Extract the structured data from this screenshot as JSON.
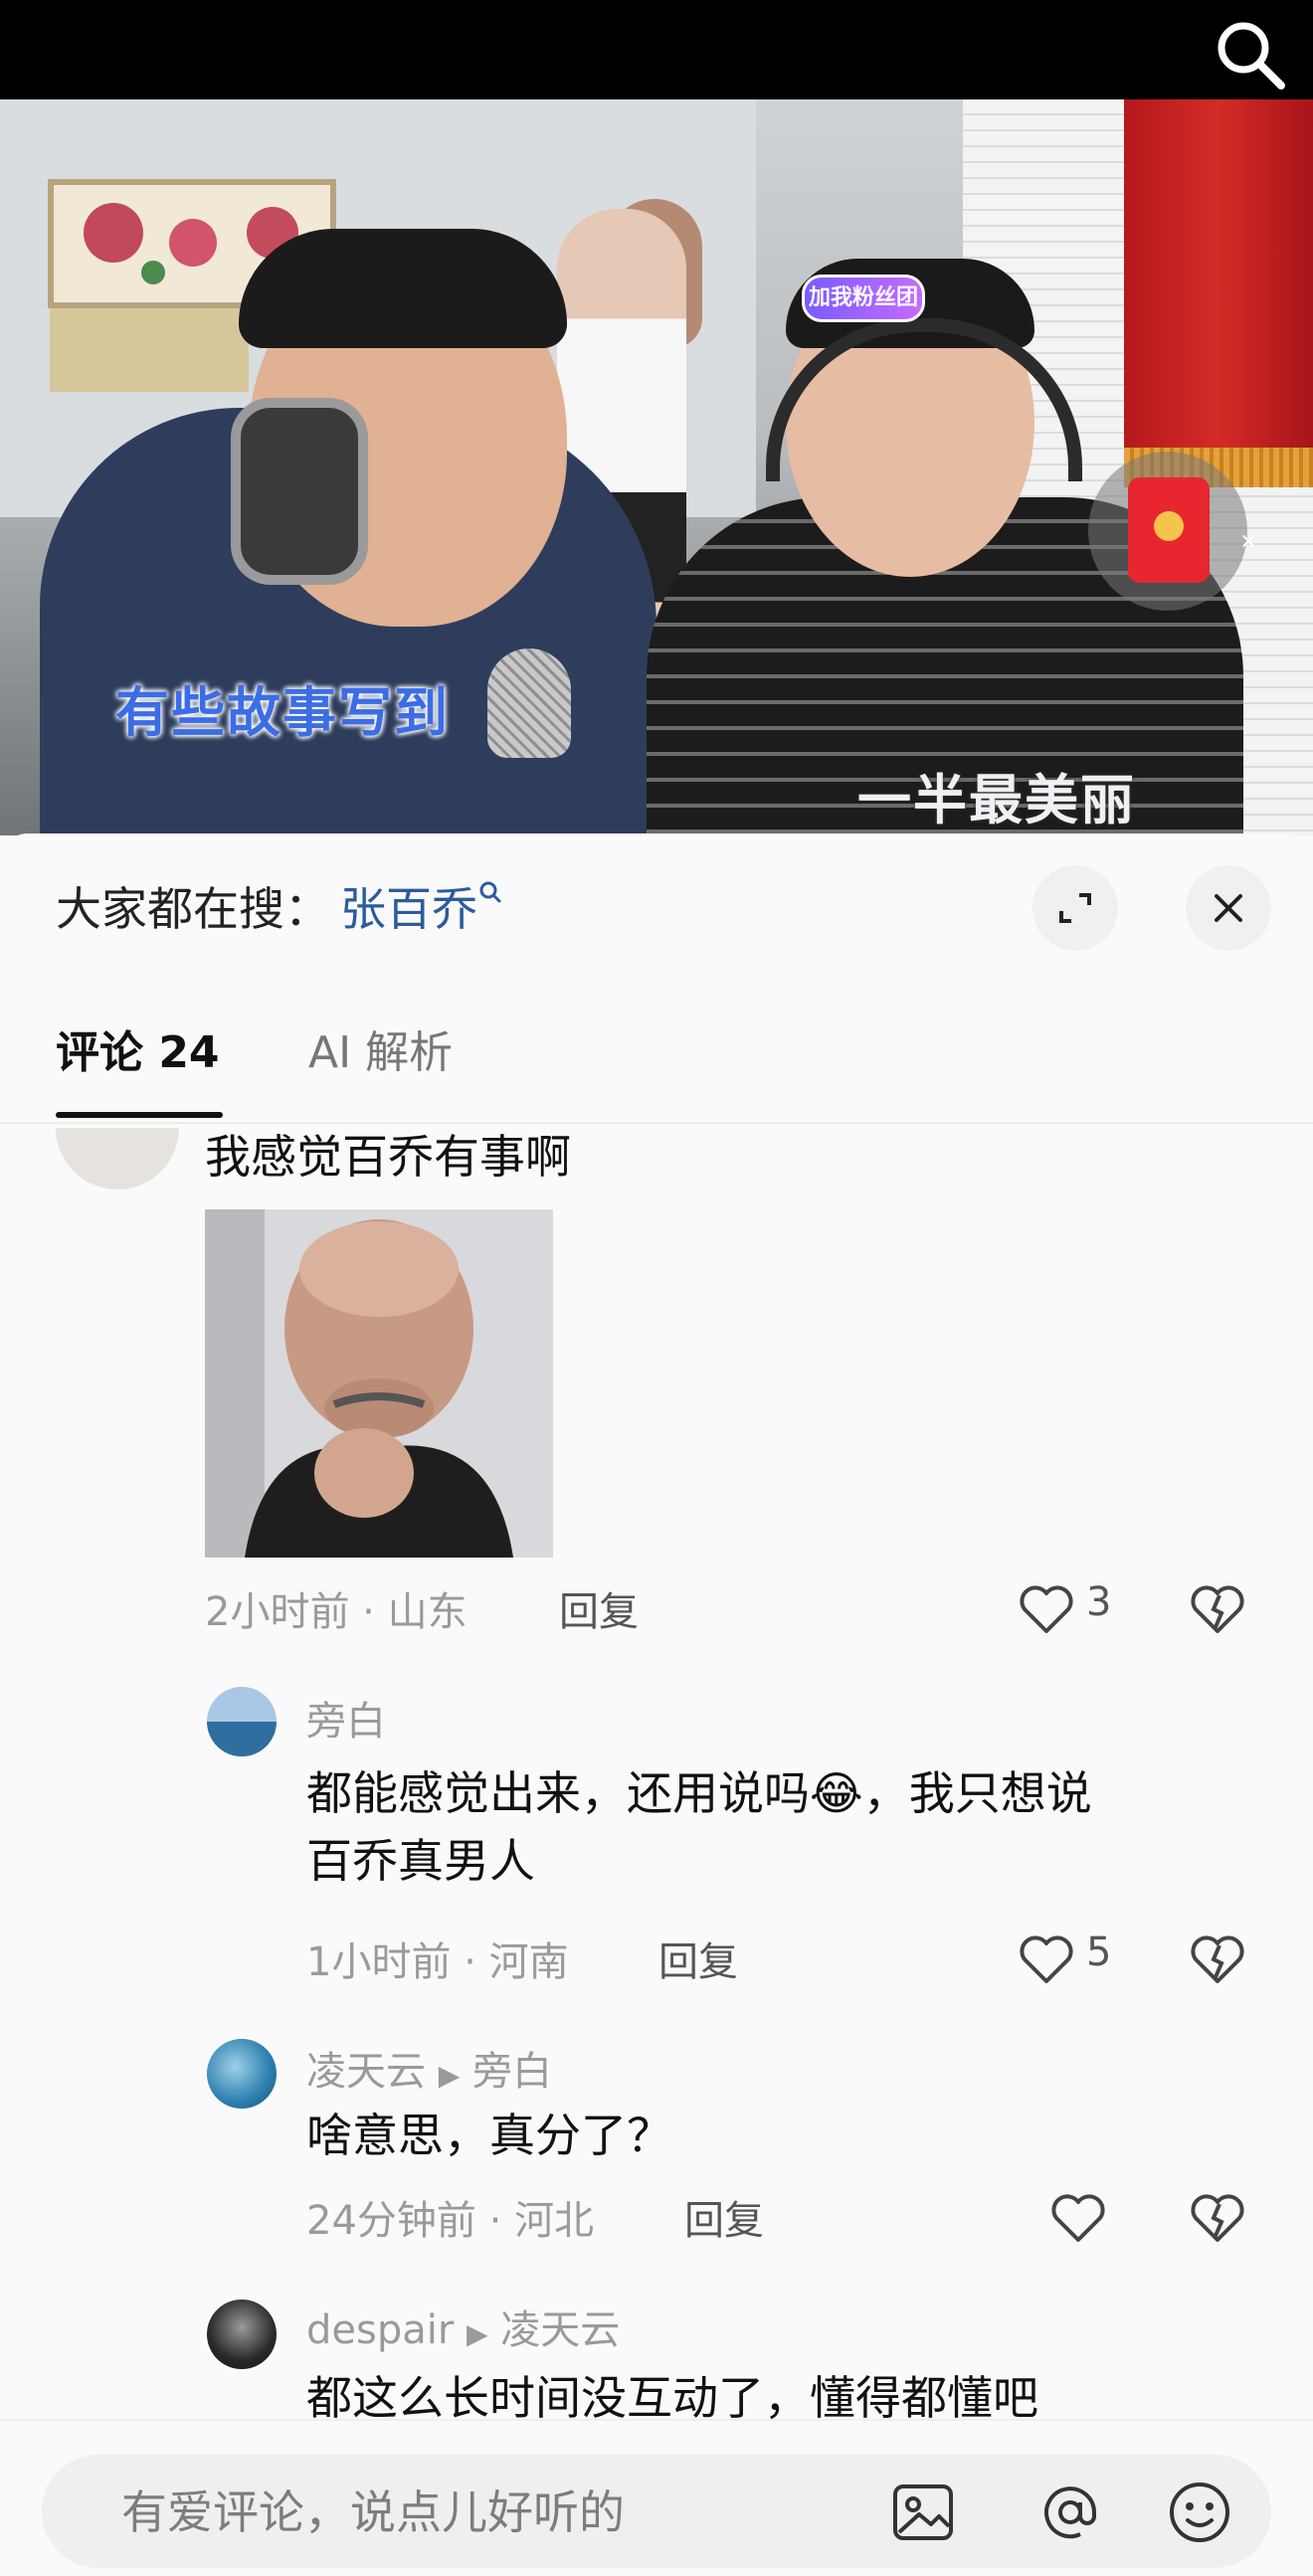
{
  "video": {
    "subtitle_left": "有些故事写到",
    "subtitle_right": "一半最美丽",
    "fan_badge": "加我粉丝团"
  },
  "sheet": {
    "hot_search_label": "大家都在搜：",
    "hot_search_term": "张百乔",
    "tabs": [
      {
        "label": "评论 24",
        "active": true
      },
      {
        "label": "AI 解析",
        "active": false
      }
    ]
  },
  "comments": [
    {
      "text": "我感觉百乔有事啊",
      "has_image": true,
      "time": "2小时前",
      "location": "山东",
      "reply_label": "回复",
      "likes": "3"
    },
    {
      "author": "旁白",
      "text_line1": "都能感觉出来，还用说吗",
      "emoji": "😂",
      "text_line1_tail": "，我只想说",
      "text_line2": "百乔真男人",
      "time": "1小时前",
      "location": "河南",
      "reply_label": "回复",
      "likes": "5"
    },
    {
      "author": "凌天云",
      "reply_to": "旁白",
      "text": "啥意思，真分了？",
      "time": "24分钟前",
      "location": "河北",
      "reply_label": "回复",
      "likes": ""
    },
    {
      "author": "despair",
      "reply_to": "凌天云",
      "text": "都这么长时间没互动了，懂得都懂吧"
    }
  ],
  "input": {
    "placeholder": "有爱评论，说点儿好听的"
  },
  "meta_separator": "·",
  "icons": {
    "search": "search-icon",
    "expand": "expand-icon",
    "close": "close-icon",
    "like": "heart-icon",
    "dislike": "broken-heart-icon",
    "image": "image-icon",
    "mention": "at-icon",
    "emoji": "emoji-icon",
    "reply_arrow": "play-arrow-icon"
  }
}
